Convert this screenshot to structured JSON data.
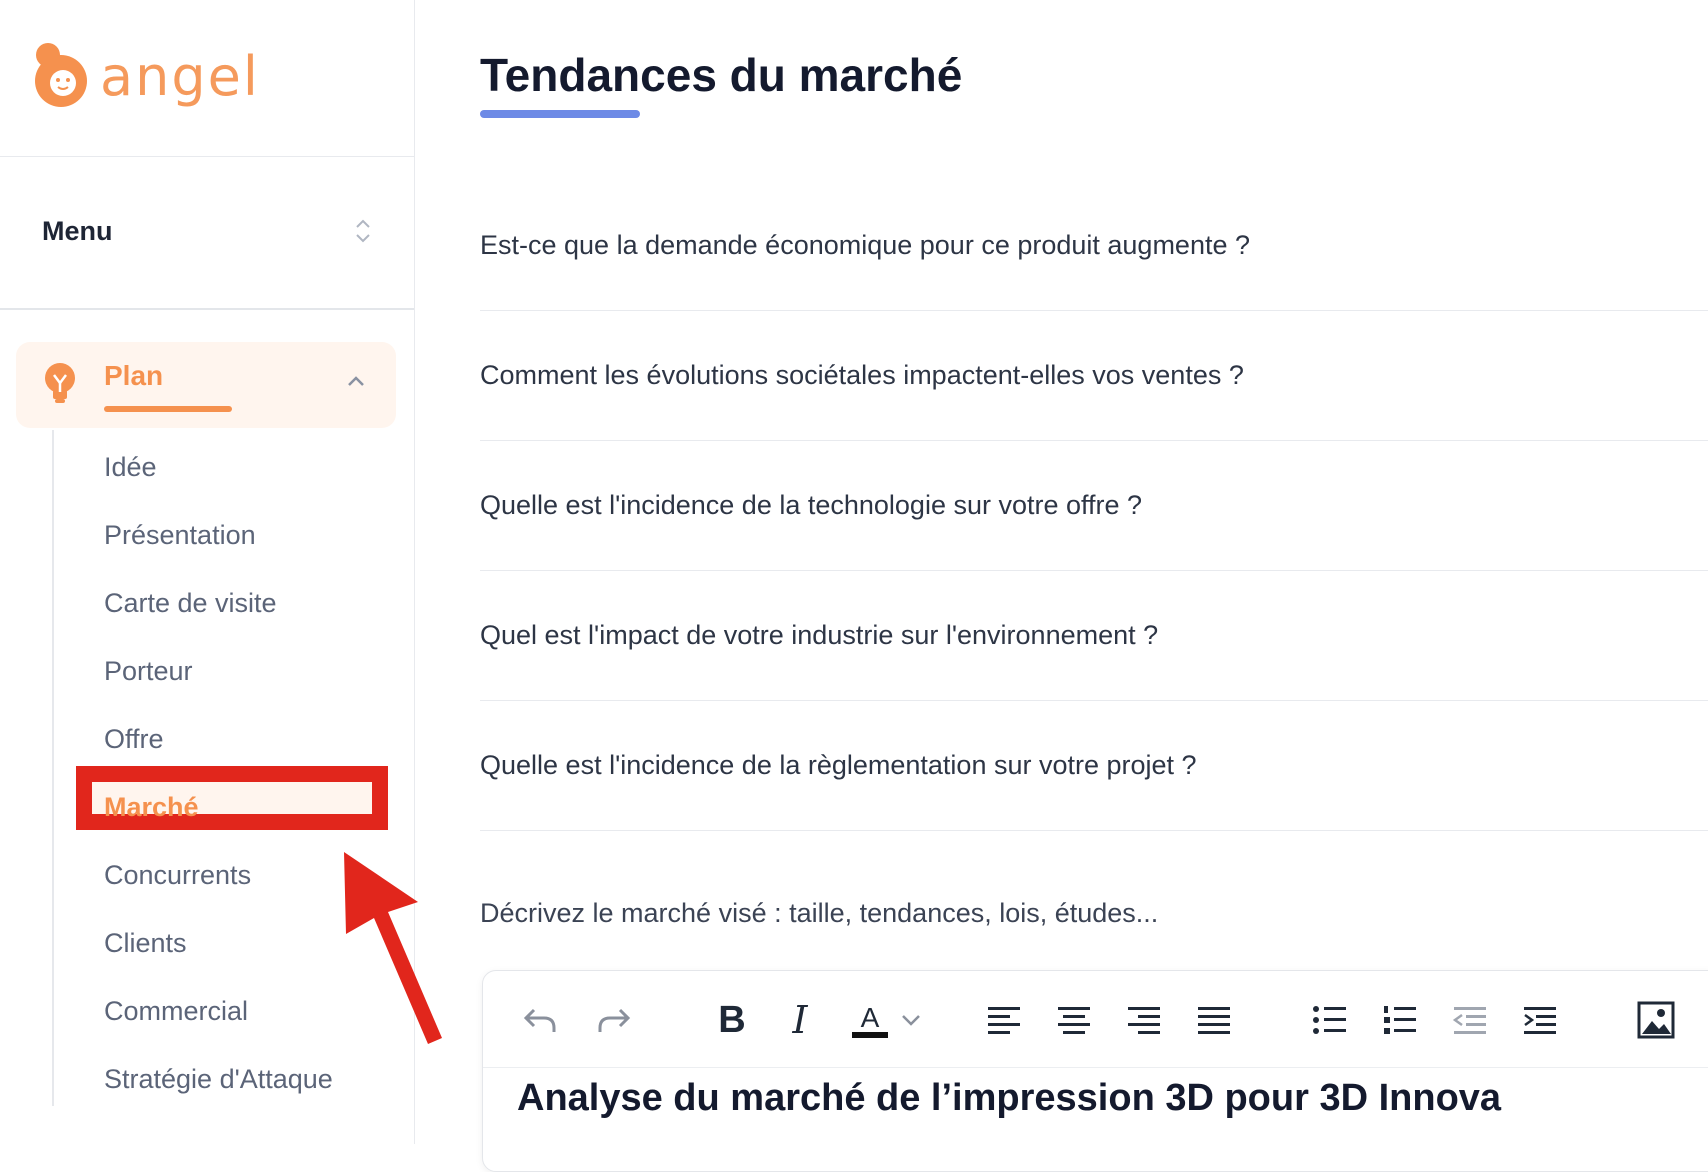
{
  "brand": {
    "name": "angel",
    "color": "#f59a5c"
  },
  "sidebar": {
    "menu_label": "Menu",
    "section": {
      "label": "Plan",
      "icon": "lightbulb-icon",
      "expanded": true
    },
    "items": [
      {
        "label": "Idée"
      },
      {
        "label": "Présentation"
      },
      {
        "label": "Carte de visite"
      },
      {
        "label": "Porteur"
      },
      {
        "label": "Offre"
      },
      {
        "label": "Marché",
        "active": true
      },
      {
        "label": "Concurrents"
      },
      {
        "label": "Clients"
      },
      {
        "label": "Commercial"
      },
      {
        "label": "Stratégie d'Attaque"
      }
    ]
  },
  "main": {
    "title": "Tendances du marché",
    "questions": [
      "Est-ce que la demande économique pour ce produit augmente ?",
      "Comment les évolutions sociétales impactent-elles vos ventes ?",
      "Quelle est l'incidence de la technologie sur votre offre ?",
      "Quel est l'impact de votre industrie sur l'environnement ?",
      "Quelle est l'incidence de la règlementation sur votre projet ?"
    ],
    "editor_prompt": "Décrivez le marché visé : taille, tendances, lois, études...",
    "editor": {
      "toolbar": [
        "undo-icon",
        "redo-icon",
        "bold-icon",
        "italic-icon",
        "text-color-icon",
        "chevron-down-icon",
        "align-left-icon",
        "align-center-icon",
        "align-right-icon",
        "align-justify-icon",
        "bullet-list-icon",
        "numbered-list-icon",
        "outdent-icon",
        "indent-icon",
        "image-icon"
      ],
      "bold_glyph": "B",
      "italic_glyph": "I",
      "color_glyph": "A",
      "content_heading": "Analyse du marché de l’impression 3D pour 3D Innova"
    }
  },
  "colors": {
    "accent": "#f5914e",
    "title_underline": "#6d8ae6",
    "annotation": "#e1261c"
  }
}
